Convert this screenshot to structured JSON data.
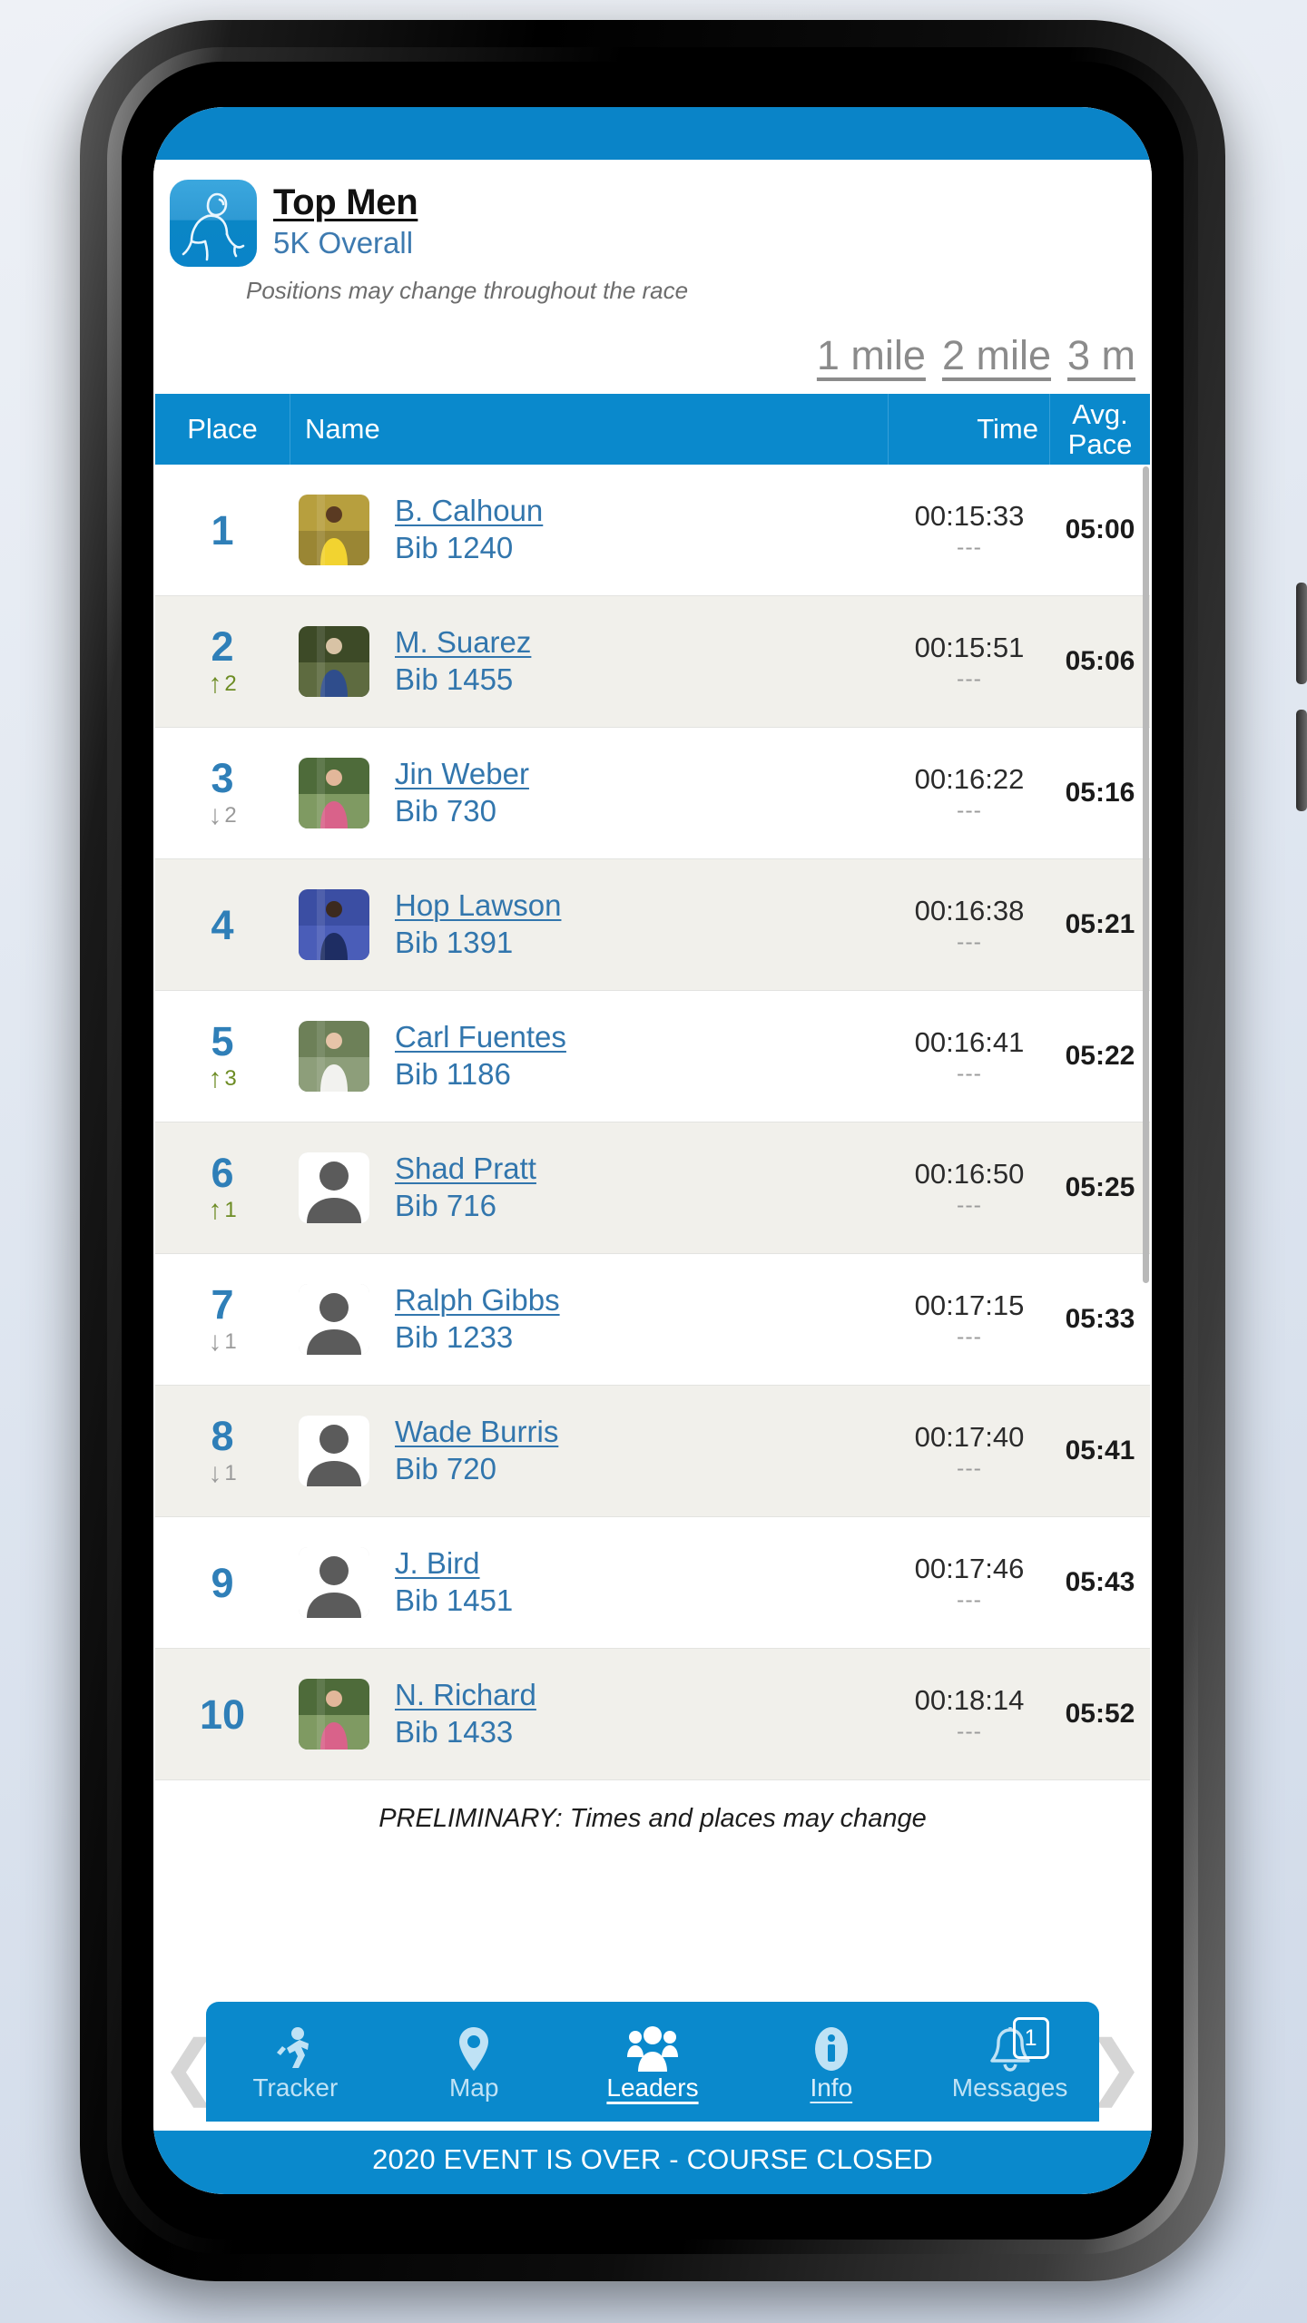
{
  "header": {
    "title": "Top Men",
    "subtitle": "5K Overall",
    "note": "Positions may change throughout the race",
    "app_icon": "runner-icon"
  },
  "split_tabs": [
    {
      "label": "1 mile"
    },
    {
      "label": "2 mile"
    },
    {
      "label": "3 m"
    }
  ],
  "table": {
    "columns": {
      "place": "Place",
      "name": "Name",
      "time": "Time",
      "pace_line1": "Avg.",
      "pace_line2": "Pace"
    },
    "rows": [
      {
        "place": "1",
        "delta_dir": "",
        "delta_n": "",
        "name": "B. Calhoun",
        "bib": "Bib 1240",
        "time": "00:15:33",
        "time_sub": "---",
        "pace": "05:00",
        "photo": "runner-photo-yellow-singlet"
      },
      {
        "place": "2",
        "delta_dir": "up",
        "delta_n": "2",
        "name": "M. Suarez",
        "bib": "Bib 1455",
        "time": "00:15:51",
        "time_sub": "---",
        "pace": "05:06",
        "photo": "runner-photo-blue-singlet"
      },
      {
        "place": "3",
        "delta_dir": "down",
        "delta_n": "2",
        "name": "Jin Weber",
        "bib": "Bib 730",
        "time": "00:16:22",
        "time_sub": "---",
        "pace": "05:16",
        "photo": "runner-photo-pink-top"
      },
      {
        "place": "4",
        "delta_dir": "",
        "delta_n": "",
        "name": "Hop Lawson",
        "bib": "Bib 1391",
        "time": "00:16:38",
        "time_sub": "---",
        "pace": "05:21",
        "photo": "runner-photo-dark-blue"
      },
      {
        "place": "5",
        "delta_dir": "up",
        "delta_n": "3",
        "name": "Carl Fuentes",
        "bib": "Bib 1186",
        "time": "00:16:41",
        "time_sub": "---",
        "pace": "05:22",
        "photo": "runner-photo-white-singlet"
      },
      {
        "place": "6",
        "delta_dir": "up",
        "delta_n": "1",
        "name": "Shad Pratt",
        "bib": "Bib 716",
        "time": "00:16:50",
        "time_sub": "---",
        "pace": "05:25",
        "photo": "silhouette-avatar"
      },
      {
        "place": "7",
        "delta_dir": "down",
        "delta_n": "1",
        "name": "Ralph Gibbs",
        "bib": "Bib 1233",
        "time": "00:17:15",
        "time_sub": "---",
        "pace": "05:33",
        "photo": "silhouette-avatar"
      },
      {
        "place": "8",
        "delta_dir": "down",
        "delta_n": "1",
        "name": "Wade Burris",
        "bib": "Bib 720",
        "time": "00:17:40",
        "time_sub": "---",
        "pace": "05:41",
        "photo": "silhouette-avatar"
      },
      {
        "place": "9",
        "delta_dir": "",
        "delta_n": "",
        "name": "J. Bird",
        "bib": "Bib 1451",
        "time": "00:17:46",
        "time_sub": "---",
        "pace": "05:43",
        "photo": "silhouette-avatar"
      },
      {
        "place": "10",
        "delta_dir": "",
        "delta_n": "",
        "name": "N. Richard",
        "bib": "Bib 1433",
        "time": "00:18:14",
        "time_sub": "---",
        "pace": "05:52",
        "photo": "runner-photo-pink-top"
      }
    ]
  },
  "preliminary_note": "PRELIMINARY: Times and places may change",
  "bottom_nav": {
    "prev_label": "❮",
    "next_label": "❯",
    "items": [
      {
        "label": "Tracker",
        "icon": "runner-icon",
        "state": "inactive",
        "badge": ""
      },
      {
        "label": "Map",
        "icon": "map-pin-icon",
        "state": "inactive",
        "badge": ""
      },
      {
        "label": "Leaders",
        "icon": "people-icon",
        "state": "active",
        "badge": ""
      },
      {
        "label": "Info",
        "icon": "info-icon",
        "state": "semi",
        "badge": ""
      },
      {
        "label": "Messages",
        "icon": "bell-icon",
        "state": "inactive",
        "badge": "1"
      }
    ]
  },
  "footer": {
    "text": "2020 EVENT IS OVER - COURSE CLOSED"
  },
  "colors": {
    "brand_blue": "#0a89cc",
    "status_blue": "#0a84c8",
    "link_blue": "#3276ad",
    "place_blue": "#2f7fb8",
    "up_green": "#6d8c24",
    "down_gray": "#9a9a9a",
    "row_alt": "#f1f0eb"
  }
}
